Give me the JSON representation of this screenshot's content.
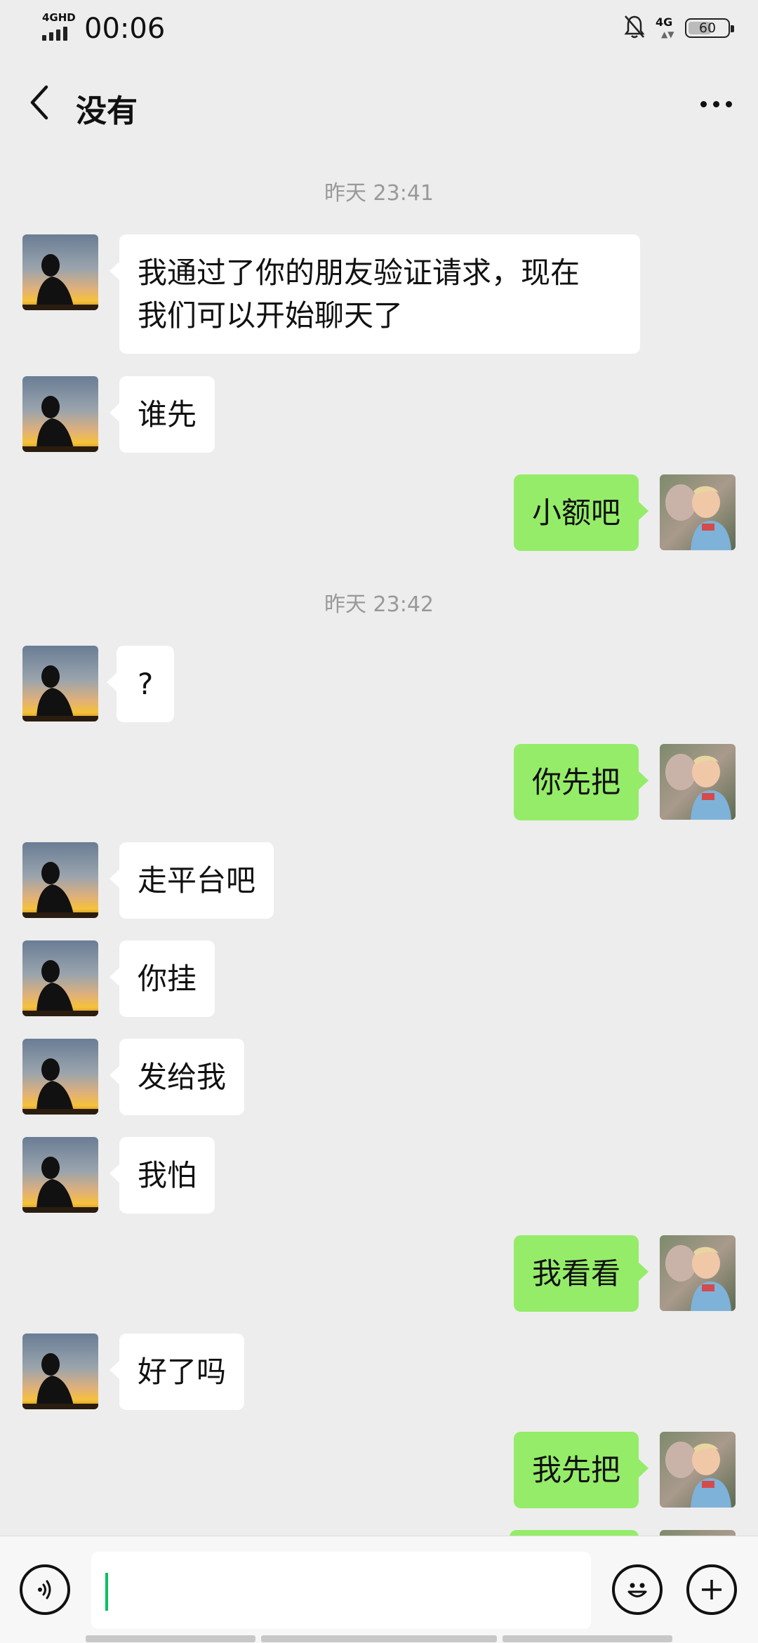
{
  "status_bar": {
    "network_left": "4GHD",
    "time": "00:06",
    "network_right": "4G",
    "battery": "60",
    "battery_level": 0.6,
    "icons": [
      "signal-icon",
      "mute-bell-icon",
      "battery-icon"
    ]
  },
  "header": {
    "title": "没有",
    "back_icon": "chevron-left-icon",
    "more_icon": "more-dots-icon"
  },
  "chat": {
    "time_separators": [
      "昨天 23:41",
      "昨天 23:42"
    ],
    "messages": [
      {
        "side": "left",
        "text_lines": [
          "我通过了你的朋友验证请求，现在",
          "我们可以开始聊天了"
        ]
      },
      {
        "side": "left",
        "text": "谁先"
      },
      {
        "side": "right",
        "text": "小额吧"
      },
      {
        "side": "left",
        "text": "?"
      },
      {
        "side": "right",
        "text": "你先把"
      },
      {
        "side": "left",
        "text": "走平台吧"
      },
      {
        "side": "left",
        "text": "你挂"
      },
      {
        "side": "left",
        "text": "发给我"
      },
      {
        "side": "left",
        "text": "我怕"
      },
      {
        "side": "right",
        "text": "我看看"
      },
      {
        "side": "left",
        "text": "好了吗"
      },
      {
        "side": "right",
        "text": "我先把"
      }
    ]
  },
  "input_bar": {
    "value": "",
    "icons": [
      "voice-icon",
      "emoji-icon",
      "plus-icon"
    ]
  },
  "colors": {
    "background": "#ededed",
    "bubble_sent": "#95ec69",
    "bubble_received": "#ffffff",
    "caret": "#07c160"
  }
}
